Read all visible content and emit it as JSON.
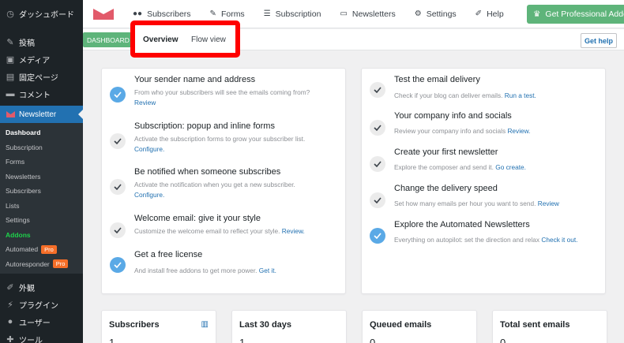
{
  "wp_menu": {
    "dashboard": "ダッシュボード",
    "posts": "投稿",
    "media": "メディア",
    "pages": "固定ページ",
    "comments": "コメント",
    "newsletter": "Newsletter",
    "appearance": "外観",
    "plugins": "プラグイン",
    "users": "ユーザー",
    "tools": "ツール"
  },
  "newsletter_submenu": [
    {
      "label": "Dashboard"
    },
    {
      "label": "Subscription"
    },
    {
      "label": "Forms"
    },
    {
      "label": "Newsletters"
    },
    {
      "label": "Subscribers"
    },
    {
      "label": "Lists"
    },
    {
      "label": "Settings"
    },
    {
      "label": "Addons"
    },
    {
      "label": "Automated",
      "badge": "Pro"
    },
    {
      "label": "Autoresponder",
      "badge": "Pro"
    }
  ],
  "topnav": {
    "subscribers": "Subscribers",
    "forms": "Forms",
    "subscription": "Subscription",
    "newsletters": "Newsletters",
    "settings": "Settings",
    "help": "Help",
    "get_pro": "Get Professional Addons"
  },
  "subbar": {
    "crumb": "DASHBOARD",
    "tab_overview": "Overview",
    "tab_flow": "Flow view",
    "get_help": "Get help"
  },
  "left_tasks": [
    {
      "title": "Your sender name and address",
      "desc": "From who your subscribers will see the emails coming from?",
      "link": "Review",
      "done": true
    },
    {
      "title": "Subscription: popup and inline forms",
      "desc": "Activate the subscription forms to grow your subscriber list.",
      "link": "Configure.",
      "done": false
    },
    {
      "title": "Be notified when someone subscribes",
      "desc": "Activate the notification when you get a new subscriber.",
      "link": "Configure.",
      "done": false
    },
    {
      "title": "Welcome email: give it your style",
      "desc": "Customize the welcome email to reflect your style.",
      "link": "Review.",
      "done": false
    },
    {
      "title": "Get a free license",
      "desc": "And install free addons to get more power.",
      "link": "Get it.",
      "done": true
    }
  ],
  "right_tasks": [
    {
      "title": "Test the email delivery",
      "desc": "Check if your blog can deliver emails.",
      "link": "Run a test.",
      "done": false
    },
    {
      "title": "Your company info and socials",
      "desc": "Review your company info and socials",
      "link": "Review.",
      "done": false
    },
    {
      "title": "Create your first newsletter",
      "desc": "Explore the composer and send it.",
      "link": "Go create.",
      "done": false
    },
    {
      "title": "Change the delivery speed",
      "desc": "Set how many emails per hour you want to send.",
      "link": "Review",
      "done": false
    },
    {
      "title": "Explore the Automated Newsletters",
      "desc": "Everything on autopilot: set the direction and relax",
      "link": "Check it out.",
      "done": true
    }
  ],
  "stats": [
    {
      "title": "Subscribers",
      "value": "1"
    },
    {
      "title": "Last 30 days",
      "value": "1"
    },
    {
      "title": "Queued emails",
      "value": "0"
    },
    {
      "title": "Total sent emails",
      "value": "0"
    }
  ],
  "colors": {
    "accent_green": "#5eb47a",
    "highlight_red": "#ff0000",
    "check_blue": "#5aa9e6",
    "wp_dark": "#1d2327",
    "wp_blue": "#2271b1"
  }
}
